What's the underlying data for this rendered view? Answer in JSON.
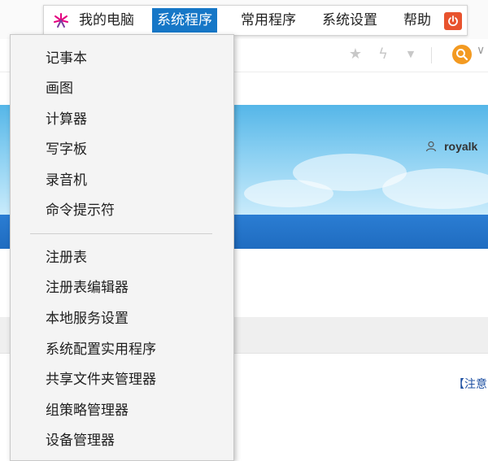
{
  "menubar": {
    "items": [
      {
        "label": "我的电脑"
      },
      {
        "label": "系统程序"
      },
      {
        "label": "常用程序"
      },
      {
        "label": "系统设置"
      },
      {
        "label": "帮助"
      }
    ],
    "active_index": 1
  },
  "dropdown": {
    "group1": [
      {
        "label": "记事本"
      },
      {
        "label": "画图"
      },
      {
        "label": "计算器"
      },
      {
        "label": "写字板"
      },
      {
        "label": "录音机"
      },
      {
        "label": "命令提示符"
      }
    ],
    "group2": [
      {
        "label": "注册表"
      },
      {
        "label": "注册表编辑器"
      },
      {
        "label": "本地服务设置"
      },
      {
        "label": "系统配置实用程序"
      },
      {
        "label": "共享文件夹管理器"
      },
      {
        "label": "组策略管理器"
      },
      {
        "label": "设备管理器"
      }
    ]
  },
  "background": {
    "username": "royalk",
    "link_text": "【注意",
    "toolbar_icons": [
      "star-icon",
      "lightning-icon",
      "dropdown-arrow-icon",
      "search-icon"
    ]
  },
  "colors": {
    "active_menu": "#1677c7",
    "power_button": "#e8532e",
    "search_button": "#f39a21",
    "navbar_blue": "#1f6cc0",
    "link_blue": "#1e50a2"
  }
}
